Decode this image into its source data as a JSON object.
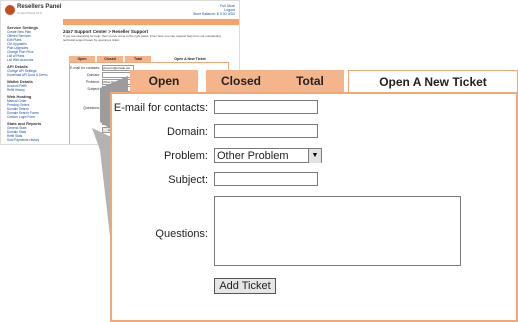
{
  "mini": {
    "logo_title": "Resellers Panel",
    "logo_subtitle": "Control Panel v2.0",
    "top_links": [
      "Full Store",
      "Logout",
      "Store Balance: $ 0.00 USD"
    ],
    "nav": [
      "Home",
      "Contact us",
      "FAQ",
      "Hosting Store"
    ],
    "sidebar": [
      {
        "head": "Service Settings",
        "items": [
          "Create New Plan",
          "Offered Services",
          "Edit Plans",
          "CM Upgrades",
          "Plan Upgrades",
          "Change Plan Price",
          "List of Plans",
          "List Web Accounts"
        ]
      },
      {
        "head": "API Details",
        "items": [
          "Change API Settings",
          "Download API Docs & Demo"
        ]
      },
      {
        "head": "Wallet Details",
        "items": [
          "Account Refill",
          "Refill History"
        ]
      },
      {
        "head": "Web Hosting",
        "items": [
          "Manual Order",
          "Pending Orders",
          "Domain Search",
          "Domain Search Forms",
          "Custom Login Form"
        ]
      },
      {
        "head": "Stats and Reports",
        "items": [
          "General Stats",
          "Domain Stats",
          "Refill Stats",
          "Sold Payments History"
        ]
      }
    ],
    "title": "24x7 Support Center > Reseller Support",
    "desc": "If you are searching for help, then you've come to the right place. From here you can request help from our outstanding technical support team by opening a ticket.",
    "tabs": [
      "Open",
      "Closed",
      "Total",
      "Open A New Ticket"
    ],
    "labels": [
      "E-mail for contacts:",
      "Domain:",
      "Problem:",
      "Subject:",
      "Questions:"
    ],
    "email_value": "phoenix@ntrade.net",
    "problem_value": "Other Problem",
    "submit": "Add Ticket"
  },
  "tabs": {
    "open": "Open",
    "closed": "Closed",
    "total": "Total",
    "new_ticket": "Open A New Ticket"
  },
  "form": {
    "email_label": "E-mail for contacts:",
    "domain_label": "Domain:",
    "problem_label": "Problem:",
    "problem_value": "Other Problem",
    "subject_label": "Subject:",
    "questions_label": "Questions:",
    "submit_label": "Add Ticket"
  }
}
